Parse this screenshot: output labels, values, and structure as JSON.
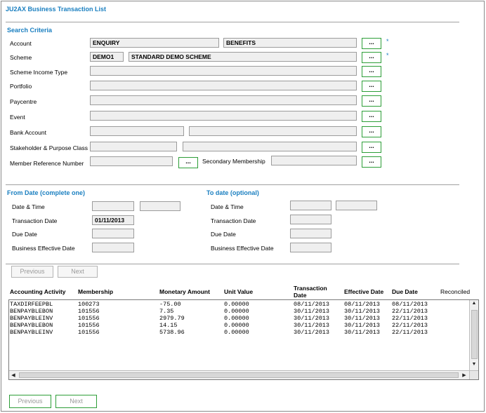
{
  "page": {
    "title": "JU2AX Business Transaction List"
  },
  "search": {
    "heading": "Search Criteria",
    "required_marker": "*",
    "dots_label": "...",
    "account": {
      "label": "Account",
      "value1": "ENQUIRY",
      "value2": "BENEFITS"
    },
    "scheme": {
      "label": "Scheme",
      "code": "DEMO1",
      "name": "STANDARD DEMO SCHEME"
    },
    "scheme_income_type": {
      "label": "Scheme Income Type",
      "value": ""
    },
    "portfolio": {
      "label": "Portfolio",
      "value": ""
    },
    "paycentre": {
      "label": "Paycentre",
      "value": ""
    },
    "event": {
      "label": "Event",
      "value": ""
    },
    "bank_account": {
      "label": "Bank Account",
      "value1": "",
      "value2": ""
    },
    "stakeholder": {
      "label": "Stakeholder & Purpose Class",
      "value1": "",
      "value2": ""
    },
    "member_ref": {
      "label": "Member Reference Number",
      "value": ""
    },
    "secondary_membership": {
      "label": "Secondary Membership",
      "value": ""
    }
  },
  "from_date": {
    "heading": "From Date (complete one)",
    "date_time": {
      "label": "Date & Time",
      "date": "",
      "time": ""
    },
    "transaction_date": {
      "label": "Transaction Date",
      "value": "01/11/2013"
    },
    "due_date": {
      "label": "Due Date",
      "value": ""
    },
    "business_effective_date": {
      "label": "Business Effective Date",
      "value": ""
    }
  },
  "to_date": {
    "heading": "To date (optional)",
    "date_time": {
      "label": "Date & Time",
      "date": "",
      "time": ""
    },
    "transaction_date": {
      "label": "Transaction Date",
      "value": ""
    },
    "due_date": {
      "label": "Due Date",
      "value": ""
    },
    "business_effective_date": {
      "label": "Business Effective Date",
      "value": ""
    }
  },
  "pager": {
    "previous": "Previous",
    "next": "Next"
  },
  "table": {
    "headers": {
      "activity": "Accounting Activity",
      "membership": "Membership",
      "amount": "Monetary Amount",
      "unit_value": "Unit Value",
      "transaction_date_line1": "Transaction",
      "transaction_date_line2": "Date",
      "effective_date": "Effective Date",
      "due_date": "Due Date",
      "reconciled": "Reconciled"
    },
    "rows": [
      {
        "activity": "TAXDIRFEEPBL",
        "membership": "100273",
        "amount": "-75.00",
        "unit_value": "0.00000",
        "transaction_date": "08/11/2013",
        "effective_date": "08/11/2013",
        "due_date": "08/11/2013"
      },
      {
        "activity": "BENPAYBLEBON",
        "membership": "101556",
        "amount": "7.35",
        "unit_value": "0.00000",
        "transaction_date": "30/11/2013",
        "effective_date": "30/11/2013",
        "due_date": "22/11/2013"
      },
      {
        "activity": "BENPAYBLEINV",
        "membership": "101556",
        "amount": "2979.79",
        "unit_value": "0.00000",
        "transaction_date": "30/11/2013",
        "effective_date": "30/11/2013",
        "due_date": "22/11/2013"
      },
      {
        "activity": "BENPAYBLEBON",
        "membership": "101556",
        "amount": "14.15",
        "unit_value": "0.00000",
        "transaction_date": "30/11/2013",
        "effective_date": "30/11/2013",
        "due_date": "22/11/2013"
      },
      {
        "activity": "BENPAYBLEINV",
        "membership": "101556",
        "amount": "5738.96",
        "unit_value": "0.00000",
        "transaction_date": "30/11/2013",
        "effective_date": "30/11/2013",
        "due_date": "22/11/2013"
      }
    ]
  },
  "icons": {
    "scroll_up": "▲",
    "scroll_down": "▼",
    "scroll_left": "◀",
    "scroll_right": "▶"
  },
  "colors": {
    "accent": "#1a7fc0",
    "button_border": "#2d9e38"
  }
}
